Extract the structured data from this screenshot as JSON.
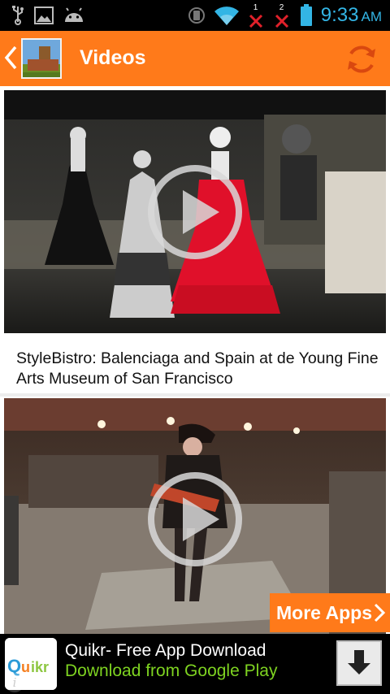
{
  "status_bar": {
    "time": "9:33",
    "ampm": "AM",
    "sim1_label": "1",
    "sim2_label": "2",
    "icons": [
      "usb-icon",
      "image-icon",
      "android-icon",
      "rotation-lock-icon",
      "wifi-icon",
      "signal-1-icon",
      "signal-2-icon",
      "battery-icon"
    ]
  },
  "app_bar": {
    "title": "Videos",
    "colors": {
      "bar": "#ff7a1a",
      "accent": "#ff7a1a"
    }
  },
  "videos": [
    {
      "caption": "StyleBistro: Balenciaga and Spain at de Young Fine Arts Museum of San Francisco"
    },
    {
      "caption": ""
    }
  ],
  "more_apps": {
    "label": "More Apps"
  },
  "ad": {
    "title": "Quikr- Free App Download",
    "subtitle": "Download from Google Play",
    "icon_text": "Quikr",
    "info_label": "i"
  }
}
